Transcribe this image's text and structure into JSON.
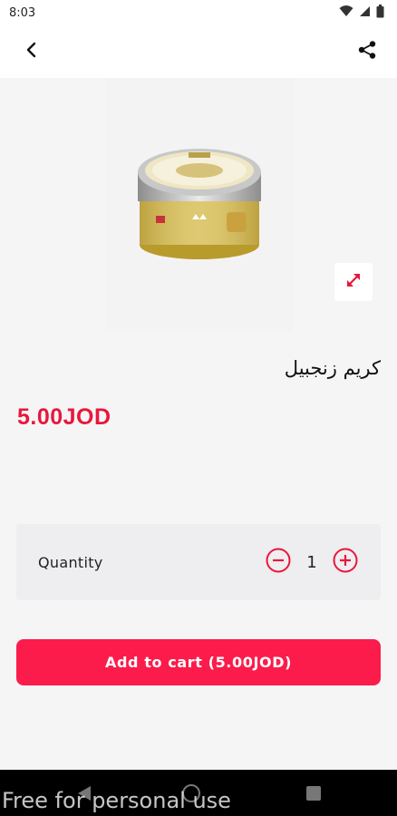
{
  "status_bar": {
    "time": "8:03"
  },
  "product": {
    "title": "كريم زنجبيل",
    "price": "5.00JOD"
  },
  "quantity": {
    "label": "Quantity",
    "value": "1"
  },
  "cart_button": {
    "label": "Add to cart (5.00JOD)"
  },
  "watermark": {
    "text": "Free for personal use"
  },
  "colors": {
    "accent": "#e8173c",
    "button": "#fb1c4b"
  }
}
